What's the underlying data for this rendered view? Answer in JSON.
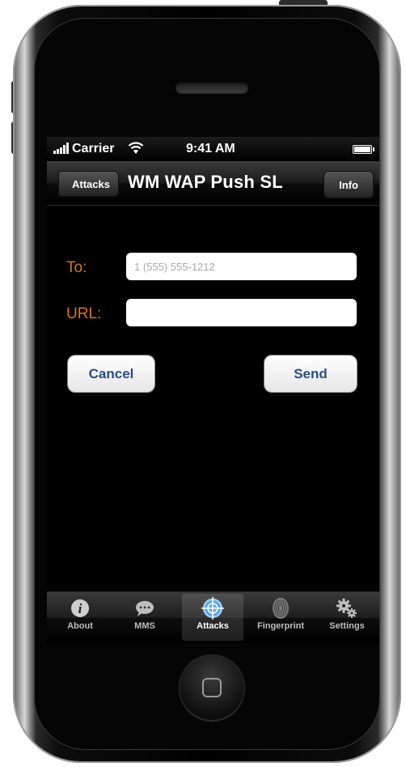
{
  "status_bar": {
    "carrier": "Carrier",
    "time": "9:41 AM"
  },
  "nav": {
    "back_label": "Attacks",
    "title": "WM WAP Push SL",
    "info_label": "Info"
  },
  "form": {
    "to_label": "To:",
    "to_placeholder": "1 (555) 555-1212",
    "url_label": "URL:",
    "url_value": ""
  },
  "actions": {
    "cancel_label": "Cancel",
    "send_label": "Send"
  },
  "tabs": [
    {
      "label": "About",
      "icon": "info-icon",
      "active": false
    },
    {
      "label": "MMS",
      "icon": "speech-bubble-icon",
      "active": false
    },
    {
      "label": "Attacks",
      "icon": "crosshair-icon",
      "active": true
    },
    {
      "label": "Fingerprint",
      "icon": "fingerprint-icon",
      "active": false
    },
    {
      "label": "Settings",
      "icon": "gears-icon",
      "active": false
    }
  ],
  "colors": {
    "label_accent": "#d9770a",
    "button_text": "#2a4d8a"
  }
}
